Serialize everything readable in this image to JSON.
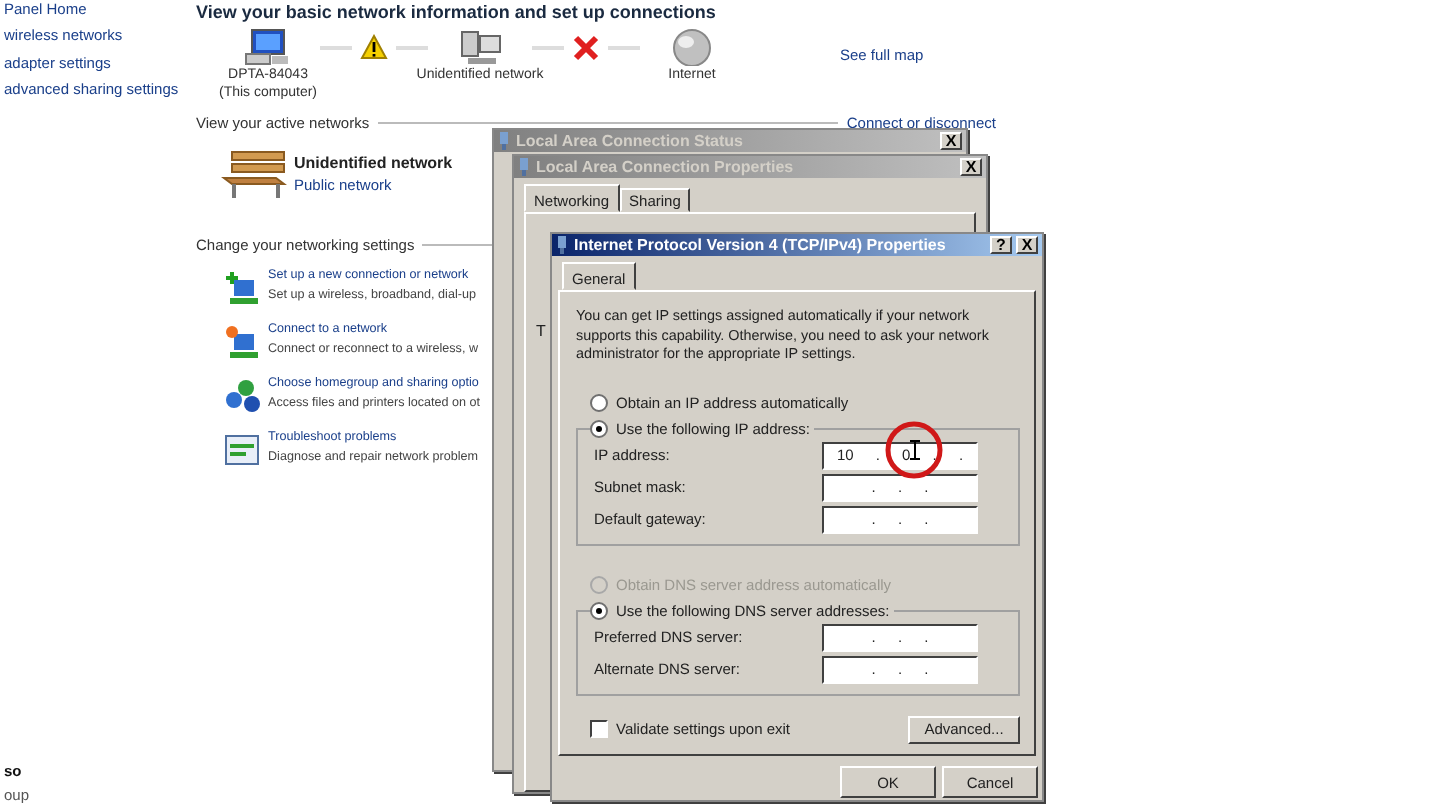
{
  "sidebar": {
    "items": [
      "Panel Home",
      "wireless networks",
      "adapter settings",
      "advanced sharing settings"
    ],
    "bottom_heading": "so",
    "bottom_items": [
      "oup"
    ]
  },
  "page": {
    "title": "View your basic network information and set up connections",
    "map": {
      "nodes": [
        {
          "kind": "computer",
          "label": "DPTA-84043",
          "sublabel": "(This computer)"
        },
        {
          "kind": "network",
          "label": "Unidentified network"
        },
        {
          "kind": "internet",
          "label": "Internet"
        }
      ],
      "links": [
        {
          "kind": "warning"
        },
        {
          "kind": "broken"
        }
      ],
      "see_full_map": "See full map"
    },
    "active_networks": {
      "heading": "View your active networks",
      "action": "Connect or disconnect",
      "network": {
        "name": "Unidentified network",
        "type": "Public network"
      }
    },
    "settings": {
      "heading": "Change your networking settings",
      "items": [
        {
          "kind": "new-connection",
          "title": "Set up a new connection or network",
          "description": "Set up a wireless, broadband, dial-up"
        },
        {
          "kind": "connect",
          "title": "Connect to a network",
          "description": "Connect or reconnect to a wireless, w"
        },
        {
          "kind": "homegroup",
          "title": "Choose homegroup and sharing optio",
          "description": "Access files and printers located on ot"
        },
        {
          "kind": "troubleshoot",
          "title": "Troubleshoot problems",
          "description": "Diagnose and repair network problem"
        }
      ]
    }
  },
  "status_window": {
    "title": "Local Area Connection Status",
    "controls": [
      "X"
    ]
  },
  "properties_window": {
    "title": "Local Area Connection Properties",
    "controls": [
      "X"
    ],
    "tabs": [
      {
        "label": "Networking",
        "selected": true
      },
      {
        "label": "Sharing",
        "selected": false
      }
    ],
    "fragments": [
      "T"
    ]
  },
  "ipv4_dialog": {
    "title": "Internet Protocol Version 4 (TCP/IPv4) Properties",
    "controls": [
      "?",
      "X"
    ],
    "tabs": [
      {
        "label": "General",
        "selected": true
      }
    ],
    "intro": "You can get IP settings assigned automatically if your network supports this capability. Otherwise, you need to ask your network administrator for the appropriate IP settings.",
    "ip_mode": [
      {
        "label": "Obtain an IP address automatically",
        "selected": false,
        "disabled": false
      },
      {
        "label": "Use the following IP address:",
        "selected": true,
        "disabled": false
      }
    ],
    "ip_fields": [
      {
        "label": "IP address:",
        "value": "10 . 0 . ."
      },
      {
        "label": "Subnet mask:",
        "value": ". . ."
      },
      {
        "label": "Default gateway:",
        "value": ". . ."
      }
    ],
    "dns_mode": [
      {
        "label": "Obtain DNS server address automatically",
        "selected": false,
        "disabled": true
      },
      {
        "label": "Use the following DNS server addresses:",
        "selected": true,
        "disabled": false
      }
    ],
    "dns_fields": [
      {
        "label": "Preferred DNS server:",
        "value": ". . ."
      },
      {
        "label": "Alternate DNS server:",
        "value": ". . ."
      }
    ],
    "validate": {
      "label": "Validate settings upon exit",
      "checked": false
    },
    "advanced_button": "Advanced...",
    "buttons": [
      "OK",
      "Cancel"
    ]
  }
}
